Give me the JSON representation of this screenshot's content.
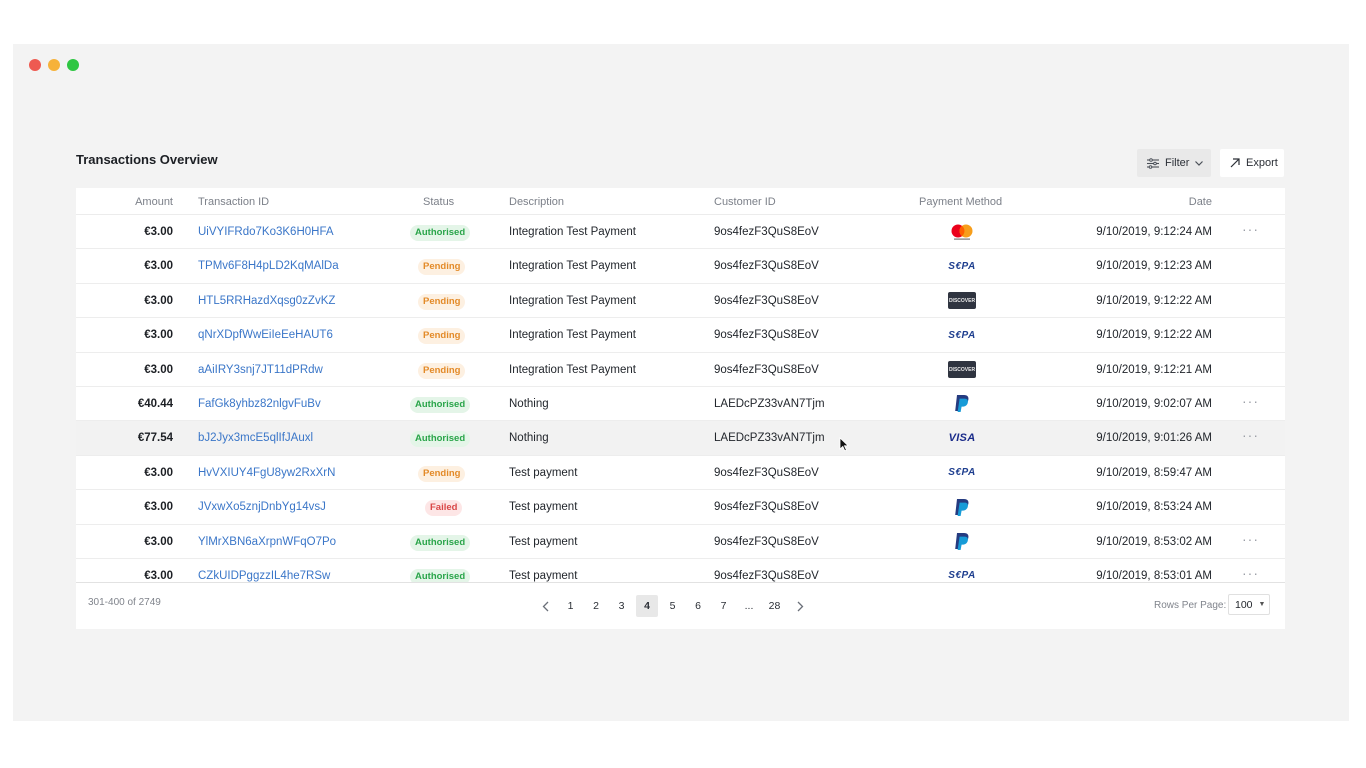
{
  "page": {
    "title": "Transactions Overview",
    "filter_label": "Filter",
    "export_label": "Export"
  },
  "table": {
    "columns": [
      "Amount",
      "Transaction ID",
      "Status",
      "Description",
      "Customer ID",
      "Payment Method",
      "Date"
    ],
    "rows": [
      {
        "amount": "€3.00",
        "txid": "UiVYIFRdo7Ko3K6H0HFA",
        "status": "Authorised",
        "description": "Integration Test Payment",
        "customer": "9os4fezF3QuS8EoV",
        "payment": "mastercard-icon",
        "date": "9/10/2019, 9:12:24 AM",
        "more": true
      },
      {
        "amount": "€3.00",
        "txid": "TPMv6F8H4pLD2KqMAlDa",
        "status": "Pending",
        "description": "Integration Test Payment",
        "customer": "9os4fezF3QuS8EoV",
        "payment": "sepa-icon",
        "date": "9/10/2019, 9:12:23 AM",
        "more": false
      },
      {
        "amount": "€3.00",
        "txid": "HTL5RRHazdXqsg0zZvKZ",
        "status": "Pending",
        "description": "Integration Test Payment",
        "customer": "9os4fezF3QuS8EoV",
        "payment": "discover-icon",
        "date": "9/10/2019, 9:12:22 AM",
        "more": false
      },
      {
        "amount": "€3.00",
        "txid": "qNrXDpfWwEiIeEeHAUT6",
        "status": "Pending",
        "description": "Integration Test Payment",
        "customer": "9os4fezF3QuS8EoV",
        "payment": "sepa-icon",
        "date": "9/10/2019, 9:12:22 AM",
        "more": false
      },
      {
        "amount": "€3.00",
        "txid": "aAiIRY3snj7JT11dPRdw",
        "status": "Pending",
        "description": "Integration Test Payment",
        "customer": "9os4fezF3QuS8EoV",
        "payment": "discover-icon",
        "date": "9/10/2019, 9:12:21 AM",
        "more": false
      },
      {
        "amount": "€40.44",
        "txid": "FafGk8yhbz82nlgvFuBv",
        "status": "Authorised",
        "description": "Nothing",
        "customer": "LAEDcPZ33vAN7Tjm",
        "payment": "paypal-icon",
        "date": "9/10/2019, 9:02:07 AM",
        "more": true
      },
      {
        "amount": "€77.54",
        "txid": "bJ2Jyx3mcE5qlIfJAuxl",
        "status": "Authorised",
        "description": "Nothing",
        "customer": "LAEDcPZ33vAN7Tjm",
        "payment": "visa-icon",
        "date": "9/10/2019, 9:01:26 AM",
        "more": true
      },
      {
        "amount": "€3.00",
        "txid": "HvVXIUY4FgU8yw2RxXrN",
        "status": "Pending",
        "description": "Test payment",
        "customer": "9os4fezF3QuS8EoV",
        "payment": "sepa-icon",
        "date": "9/10/2019, 8:59:47 AM",
        "more": false
      },
      {
        "amount": "€3.00",
        "txid": "JVxwXo5znjDnbYg14vsJ",
        "status": "Failed",
        "description": "Test payment",
        "customer": "9os4fezF3QuS8EoV",
        "payment": "paypal-icon",
        "date": "9/10/2019, 8:53:24 AM",
        "more": false
      },
      {
        "amount": "€3.00",
        "txid": "YlMrXBN6aXrpnWFqO7Po",
        "status": "Authorised",
        "description": "Test payment",
        "customer": "9os4fezF3QuS8EoV",
        "payment": "paypal-icon",
        "date": "9/10/2019, 8:53:02 AM",
        "more": true
      },
      {
        "amount": "€3.00",
        "txid": "CZkUIDPggzzIL4he7RSw",
        "status": "Authorised",
        "description": "Test payment",
        "customer": "9os4fezF3QuS8EoV",
        "payment": "sepa-icon",
        "date": "9/10/2019, 8:53:01 AM",
        "more": true
      }
    ],
    "highlighted_row": 6,
    "more_label": "···"
  },
  "payment_labels": {
    "sepa": "S€PA",
    "visa": "VISA",
    "discover": "DISCOVER"
  },
  "footer": {
    "range": "301-400 of 2749",
    "pages": [
      "1",
      "2",
      "3",
      "4",
      "5",
      "6",
      "7",
      "...",
      "28"
    ],
    "current_page": "4",
    "rows_per_page_label": "Rows Per Page:",
    "rows_per_page_value": "100"
  },
  "colors": {
    "link": "#3a76c8",
    "authorised": "#2aa54a",
    "pending": "#e38a28",
    "failed": "#d94848"
  }
}
